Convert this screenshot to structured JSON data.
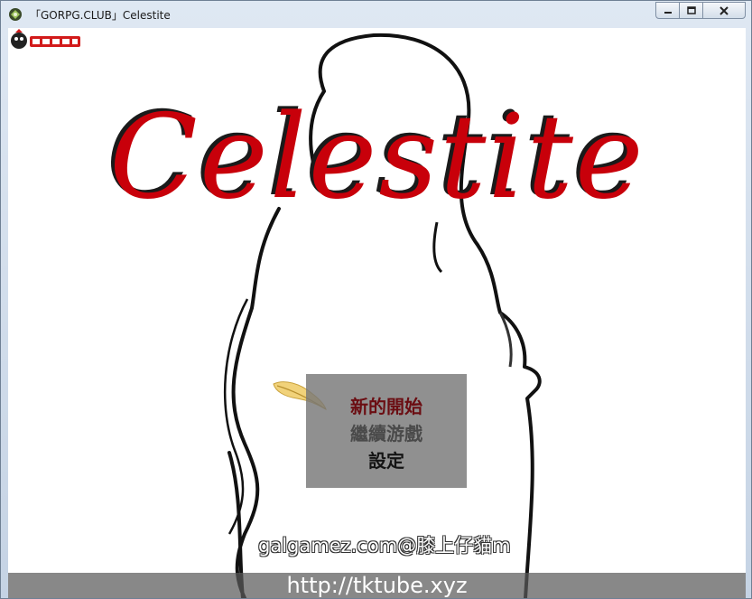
{
  "window": {
    "title": "「GORPG.CLUB」Celestite",
    "icons": {
      "app": "app-icon",
      "minimize": "minimize-icon",
      "maximize": "maximize-icon",
      "close": "close-icon"
    }
  },
  "game": {
    "logo_text": "Celestite",
    "menu": {
      "items": [
        "新的開始",
        "繼續游戲",
        "設定"
      ],
      "selected_index": 0,
      "cursor_icon": "feather-cursor-icon"
    },
    "watermark": "galgamez.com@膝上仔貓m",
    "url_banner": "http://tktube.xyz",
    "brand_logo_icon": "brand-logo-icon"
  },
  "colors": {
    "logo_red": "#c8000a",
    "selected_menu": "#6b0d12",
    "menu_bg": "#7a7a7a"
  }
}
